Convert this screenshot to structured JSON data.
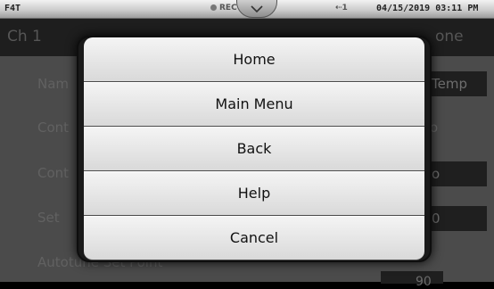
{
  "status_bar": {
    "brand": "F4T",
    "rec": "REC",
    "usb": "1",
    "clock": "04/15/2019 03:11 PM"
  },
  "background": {
    "header_channel": "Ch 1",
    "header_done": "one",
    "rows": [
      {
        "label": "Nam",
        "value": "Temp"
      },
      {
        "label": "Cont",
        "value": "o"
      },
      {
        "label": "Cont",
        "value": "o"
      },
      {
        "label": "Set",
        "value": "0"
      },
      {
        "label": "Autotune Set Point",
        "value": "90"
      }
    ]
  },
  "menu": {
    "items": [
      {
        "label": "Home"
      },
      {
        "label": "Main Menu"
      },
      {
        "label": "Back"
      },
      {
        "label": "Help"
      },
      {
        "label": "Cancel"
      }
    ]
  }
}
